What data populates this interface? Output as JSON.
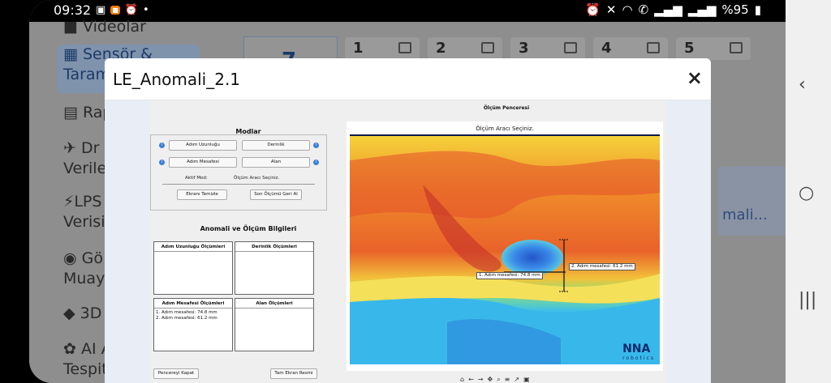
{
  "status_bar": {
    "time": "09:32",
    "battery": "%95"
  },
  "background_app": {
    "sidebar": [
      {
        "label": "Videolar",
        "icon": "video-icon"
      },
      {
        "label": "Sensör &",
        "label2": "Taram",
        "icon": "chip-icon",
        "active": true
      },
      {
        "label": "Rap",
        "icon": "report-icon"
      },
      {
        "label": "Dr",
        "label2": "Verile",
        "icon": "drone-icon"
      },
      {
        "label": "LPS",
        "label2": "Verisi",
        "icon": "bolt-icon"
      },
      {
        "label": "Gö",
        "label2": "Muay",
        "icon": "eye-icon"
      },
      {
        "label": "3D",
        "icon": "cube-icon"
      },
      {
        "label": "AI A",
        "label2": "Tespit",
        "icon": "brain-icon"
      }
    ],
    "selected_number": "7",
    "thumbnails": [
      "1",
      "2",
      "3",
      "4",
      "5"
    ],
    "card_text": "mali..."
  },
  "dialog": {
    "title": "LE_Anomali_2.1",
    "close_label": "×"
  },
  "app": {
    "modes_title": "Modlar",
    "buttons": {
      "step_length": "Adım Uzunluğu",
      "depth": "Derinlik",
      "step_distance": "Adım Mesafesi",
      "area": "Alan",
      "clear_screen": "Ekranı Temizle",
      "undo_last": "Son Ölçümü Geri Al",
      "close_window": "Pencereyi Kapat",
      "full_screenshot": "Tam Ekran Resmi"
    },
    "active_mode_label": "Aktif Mod:",
    "active_mode_value": "Ölçüm Aracı Seçiniz.",
    "info_title": "Anomali ve Ölçüm Bilgileri",
    "tables": {
      "step_length": {
        "header": "Adım Uzunluğu Ölçümleri",
        "rows": []
      },
      "depth": {
        "header": "Derinlik Ölçümleri",
        "rows": []
      },
      "step_distance": {
        "header": "Adım Mesafesi Ölçümleri",
        "rows": [
          "1. Adım mesafesi: 74.8 mm",
          "2. Adım mesafesi: 61.2 mm"
        ]
      },
      "area": {
        "header": "Alan Ölçümleri",
        "rows": []
      }
    },
    "measure_window_title": "Ölçüm Penceresi",
    "plot_title": "Ölçüm Aracı Seçiniz.",
    "measurement_labels": [
      "1. Adım mesafesi: 74.8 mm",
      "2. Adım mesafesi: 61.2 mm"
    ],
    "logo_main": "NNA",
    "logo_sub": "robotics",
    "toolbar_icons": [
      "home-icon",
      "back-icon",
      "forward-icon",
      "pan-icon",
      "zoom-icon",
      "configure-icon",
      "edit-curve-icon",
      "save-icon"
    ]
  }
}
